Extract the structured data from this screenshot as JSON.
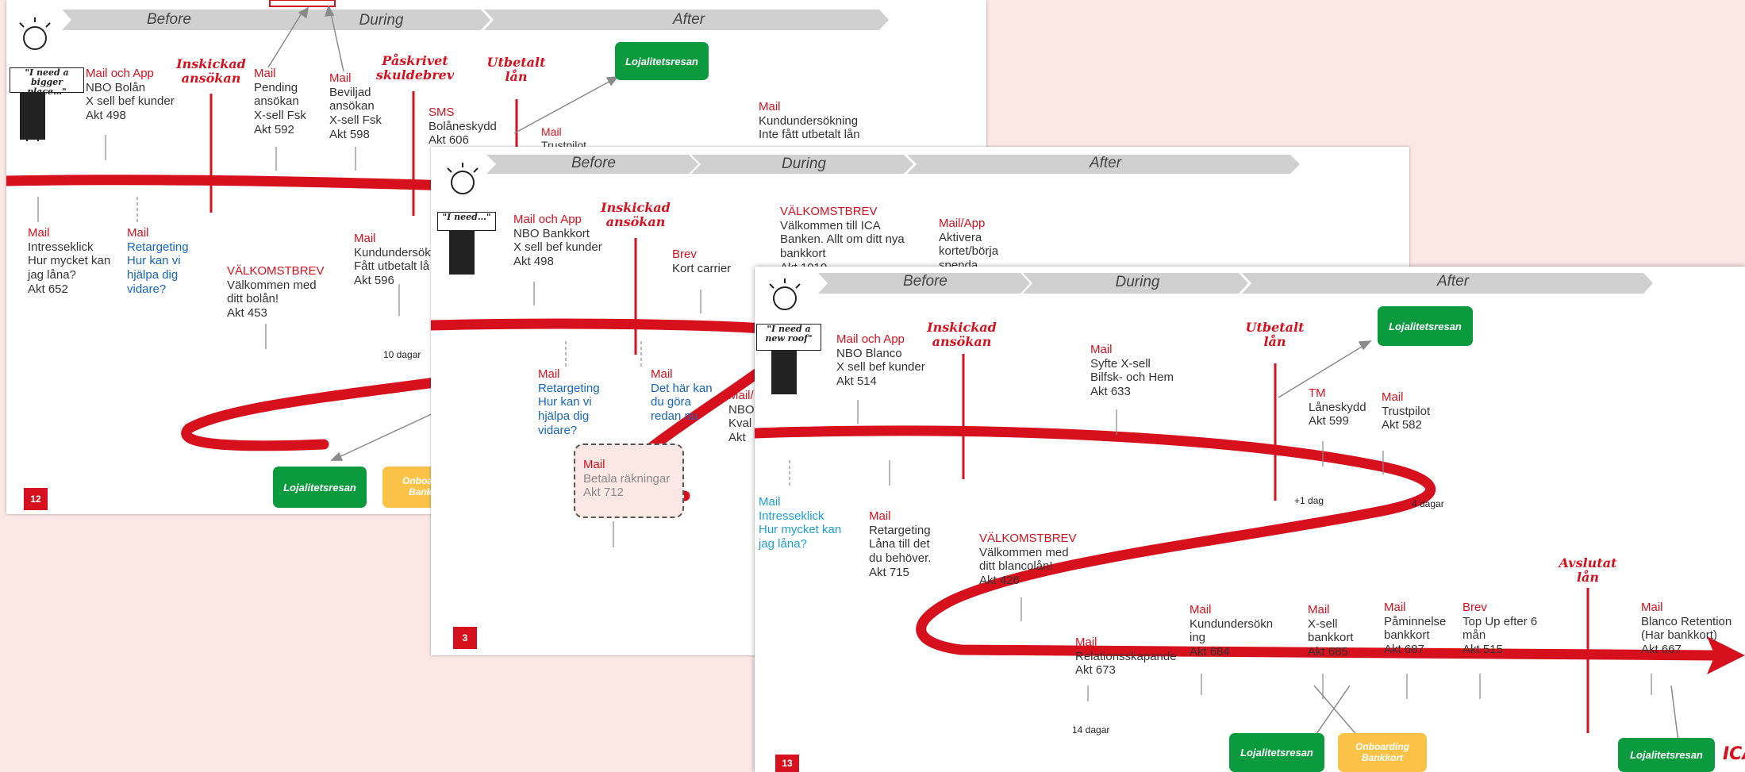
{
  "slide_back": {
    "phases": {
      "before": "Before",
      "during": "During",
      "after": "After"
    },
    "sign": "\"I need a bigger place…\"",
    "events": {
      "ansokan": "Inskickad ansökan",
      "skuldebrev": "Påskrivet skuldebrev",
      "utbetalt": "Utbetalt lån"
    },
    "above": [
      {
        "ch": "Mail",
        "ch2": "och App",
        "lines": [
          "NBO Bolån",
          "X sell bef kunder",
          "Akt 498"
        ]
      },
      {
        "ch": "Mail",
        "lines": [
          "Pending",
          "ansökan",
          "X-sell Fsk",
          "Akt 592"
        ]
      },
      {
        "ch": "Mail",
        "lines": [
          "Beviljad",
          "ansökan",
          "X-sell Fsk",
          "Akt 598"
        ]
      },
      {
        "ch": "SMS",
        "lines": [
          "Bolåneskydd",
          "Akt 606"
        ]
      },
      {
        "ch": "Mail",
        "lines": [
          "Trustpilot"
        ]
      },
      {
        "ch": "Mail",
        "lines": [
          "Kundundersökning",
          "Inte fått utbetalt lån"
        ]
      }
    ],
    "below": [
      {
        "ch": "Mail",
        "lines": [
          "Intresseklick",
          "Hur mycket kan",
          "jag låna?",
          "Akt 652"
        ]
      },
      {
        "ch": "Mail",
        "lines": [
          "Retargeting",
          "Hur kan vi",
          "hjälpa dig",
          "vidare?"
        ]
      },
      {
        "ch": "VÄLKOMSTBREV",
        "lines": [
          "Välkommen med",
          "ditt bolån!",
          "Akt 453"
        ]
      },
      {
        "ch": "Mail",
        "lines": [
          "Kundundersök",
          "Fått utbetalt lå",
          "Akt 596"
        ]
      }
    ],
    "days": "10 dagar",
    "loyalty": "Lojalitetsresan",
    "onboarding": "Onboarding Bankkort",
    "page": "12"
  },
  "slide_mid": {
    "phases": {
      "before": "Before",
      "during": "During",
      "after": "After"
    },
    "sign": "\"I need…\"",
    "events": {
      "ansokan": "Inskickad ansökan"
    },
    "above": [
      {
        "ch": "Mail",
        "ch2": "och App",
        "lines": [
          "NBO Bankkort",
          "X sell bef kunder",
          "Akt 498"
        ]
      },
      {
        "ch": "Brev",
        "lines": [
          "Kort carrier"
        ]
      },
      {
        "ch": "VÄLKOMSTBREV",
        "lines": [
          "Välkommen till ICA",
          "Banken. Allt om ditt nya",
          "bankkort",
          "Akt 1010"
        ]
      },
      {
        "ch": "Mail/App",
        "lines": [
          "Aktivera",
          "kortet/börja",
          "spenda"
        ]
      }
    ],
    "below": [
      {
        "ch": "Mail",
        "lines": [
          "Retargeting",
          "Hur kan vi",
          "hjälpa dig",
          "vidare?"
        ]
      },
      {
        "ch": "Mail",
        "lines": [
          "Det här kan",
          "du göra",
          "redan nu"
        ]
      },
      {
        "ch": "Mail/",
        "lines": [
          "NBO",
          "Kval",
          "Akt"
        ]
      }
    ],
    "dashed": {
      "ch": "Mail",
      "lines": [
        "Betala räkningar",
        "Akt 712"
      ]
    },
    "page": "3"
  },
  "slide_front": {
    "phases": {
      "before": "Before",
      "during": "During",
      "after": "After"
    },
    "sign": "\"I need a new roof\"",
    "events": {
      "ansokan": "Inskickad ansökan",
      "utbetalt": "Utbetalt lån",
      "avslutat": "Avslutat lån"
    },
    "above": [
      {
        "ch": "Mail",
        "ch2": "och App",
        "lines": [
          "NBO Blanco",
          "X sell bef kunder",
          "Akt 514"
        ]
      },
      {
        "ch": "Mail",
        "lines": [
          "Syfte X-sell",
          "Bilfsk- och Hem",
          "Akt 633"
        ]
      },
      {
        "ch": "TM",
        "lines": [
          "Låneskydd",
          "Akt 599"
        ]
      },
      {
        "ch": "Mail",
        "lines": [
          "Trustpilot",
          "Akt 582"
        ]
      }
    ],
    "below": [
      {
        "ch": "Mail",
        "lines": [
          "Intresseklick",
          "Hur mycket kan",
          "jag låna?"
        ]
      },
      {
        "ch": "Mail",
        "lines": [
          "Retargeting",
          "Låna till det",
          "du behöver.",
          "Akt 715"
        ]
      },
      {
        "ch": "VÄLKOMSTBREV",
        "lines": [
          "Välkommen med",
          "ditt blancolån!",
          "Akt 426"
        ]
      }
    ],
    "bottom": [
      {
        "ch": "Mail",
        "lines": [
          "Relationsskapande",
          "Akt 673"
        ]
      },
      {
        "ch": "Mail",
        "lines": [
          "Kundundersökn",
          "ing",
          "Akt 684"
        ]
      },
      {
        "ch": "Mail",
        "lines": [
          "X-sell",
          "bankkort",
          "Akt 685"
        ]
      },
      {
        "ch": "Mail",
        "lines": [
          "Påminnelse",
          "bankkort",
          "Akt 687"
        ]
      },
      {
        "ch": "Brev",
        "lines": [
          "Top Up efter 6",
          "mån",
          "Akt 515"
        ]
      },
      {
        "ch": "Mail",
        "lines": [
          "Blanco Retention",
          "(Har bankkort)",
          "Akt 667"
        ]
      }
    ],
    "days": {
      "d1": "+1 dag",
      "d4": "4 dagar",
      "d14": "14 dagar"
    },
    "loyalty": "Lojalitetsresan",
    "onboarding": "Onboarding Bankkort",
    "page": "13",
    "logo": "ICA"
  },
  "colors": {
    "red": "#d7101d",
    "green": "#0c9a3f",
    "orange": "#fbc248",
    "blue": "#1565c0",
    "grey": "#d0d0d0"
  }
}
